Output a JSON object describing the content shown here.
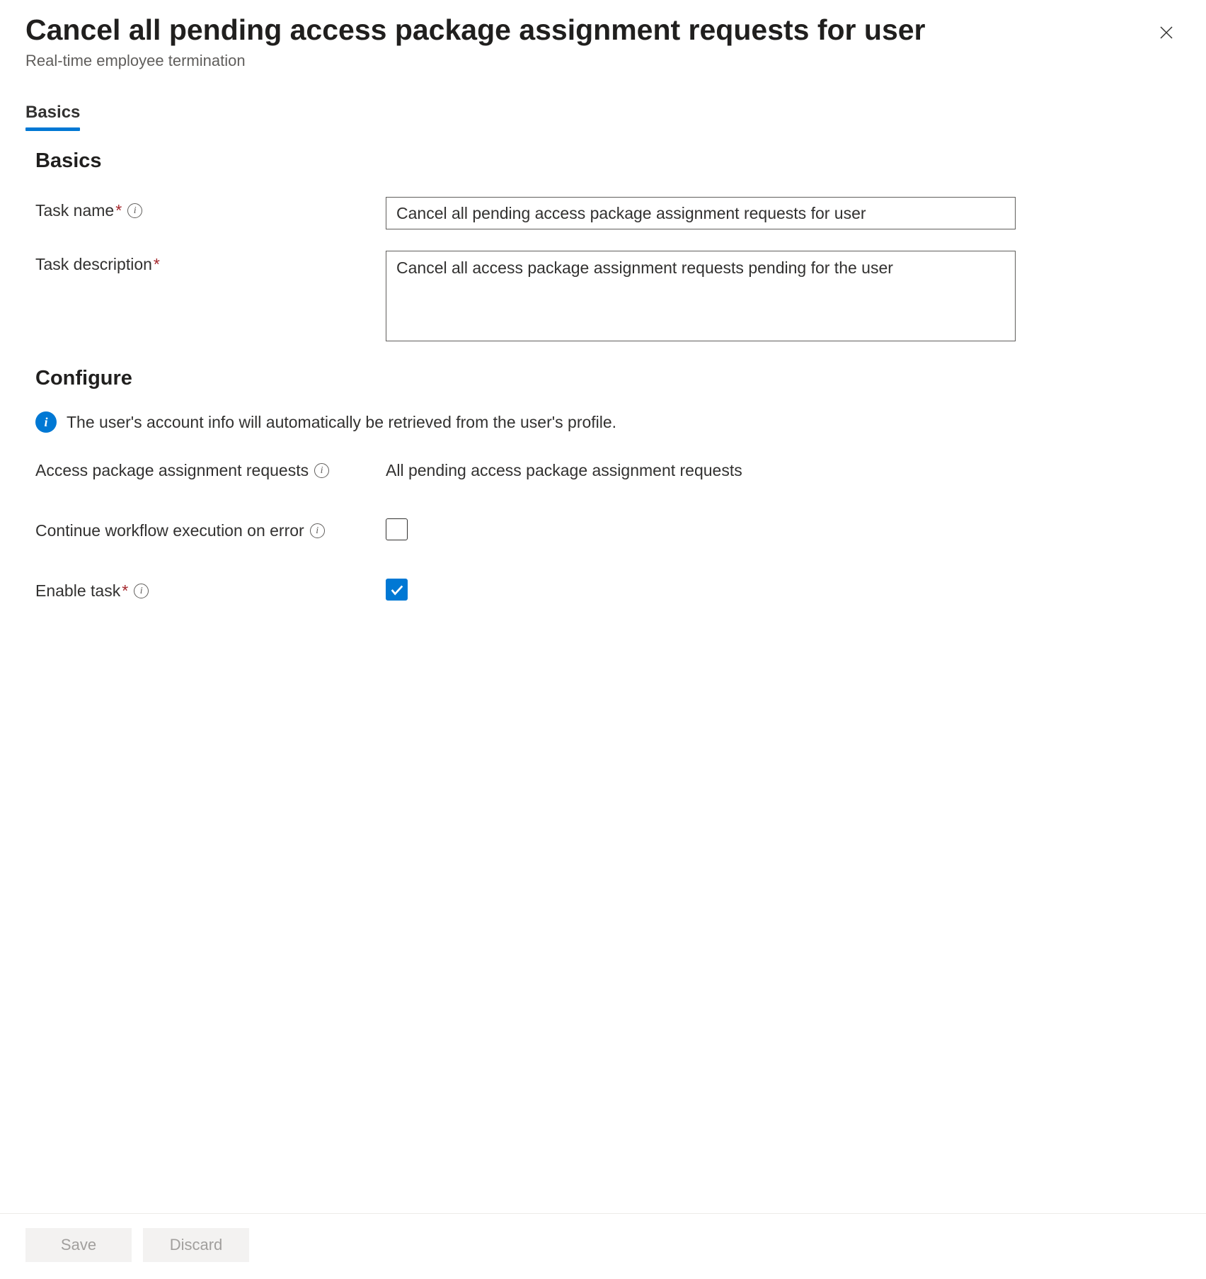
{
  "header": {
    "title": "Cancel all pending access package assignment requests for user",
    "subtitle": "Real-time employee termination"
  },
  "tabs": {
    "items": [
      {
        "label": "Basics",
        "active": true
      }
    ]
  },
  "sections": {
    "basics_title": "Basics",
    "configure_title": "Configure"
  },
  "fields": {
    "task_name": {
      "label": "Task name",
      "value": "Cancel all pending access package assignment requests for user",
      "required": true
    },
    "task_description": {
      "label": "Task description",
      "value": "Cancel all access package assignment requests pending for the user",
      "required": true
    },
    "access_package_requests": {
      "label": "Access package assignment requests",
      "value": "All pending access package assignment requests"
    },
    "continue_on_error": {
      "label": "Continue workflow execution on error",
      "checked": false
    },
    "enable_task": {
      "label": "Enable task",
      "required": true,
      "checked": true
    }
  },
  "info_banner": {
    "text": "The user's account info will automatically be retrieved from the user's profile."
  },
  "footer": {
    "save_label": "Save",
    "discard_label": "Discard"
  },
  "required_mark": "*"
}
